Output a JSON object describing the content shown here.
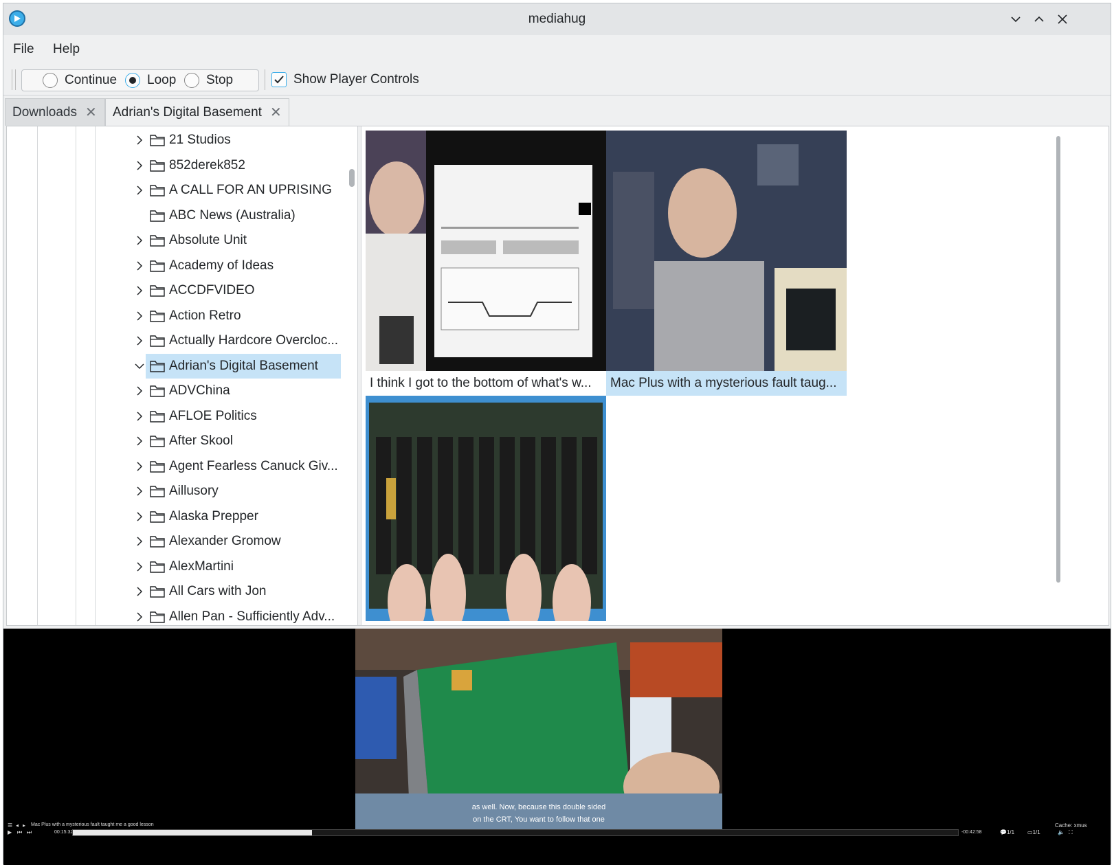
{
  "window": {
    "title": "mediahug"
  },
  "menu": {
    "items": [
      "File",
      "Help"
    ]
  },
  "toolbar": {
    "radios": [
      {
        "label": "Continue",
        "checked": false
      },
      {
        "label": "Loop",
        "checked": true
      },
      {
        "label": "Stop",
        "checked": false
      }
    ],
    "show_controls_label": "Show Player Controls",
    "show_controls_checked": true
  },
  "tabs": [
    {
      "label": "Downloads",
      "active": false
    },
    {
      "label": "Adrian's Digital Basement",
      "active": true
    }
  ],
  "tree": {
    "items": [
      {
        "label": "21 Studios",
        "expandable": true
      },
      {
        "label": "852derek852",
        "expandable": true
      },
      {
        "label": "A CALL FOR AN UPRISING",
        "expandable": true
      },
      {
        "label": "ABC News (Australia)",
        "expandable": false
      },
      {
        "label": "Absolute Unit",
        "expandable": true
      },
      {
        "label": "Academy of Ideas",
        "expandable": true
      },
      {
        "label": "ACCDFVIDEO",
        "expandable": true
      },
      {
        "label": "Action Retro",
        "expandable": true
      },
      {
        "label": "Actually Hardcore Overcloc...",
        "expandable": true
      },
      {
        "label": "Adrian's Digital Basement",
        "expandable": true,
        "expanded": true,
        "selected": true
      },
      {
        "label": "ADVChina",
        "expandable": true
      },
      {
        "label": "AFLOE Politics",
        "expandable": true
      },
      {
        "label": "After Skool",
        "expandable": true
      },
      {
        "label": "Agent Fearless Canuck Giv...",
        "expandable": true
      },
      {
        "label": "Aillusory",
        "expandable": true
      },
      {
        "label": "Alaska Prepper",
        "expandable": true
      },
      {
        "label": "Alexander Gromow",
        "expandable": true
      },
      {
        "label": "AlexMartini",
        "expandable": true
      },
      {
        "label": "All Cars with Jon",
        "expandable": true
      },
      {
        "label": "Allen Pan - Sufficiently Adv...",
        "expandable": true
      }
    ]
  },
  "videos": [
    {
      "caption": "I think I got to the bottom of what's w...",
      "highlighted": false
    },
    {
      "caption": "Mac Plus with a mysterious fault taug...",
      "highlighted": true
    },
    {
      "caption": "",
      "highlighted": false
    }
  ],
  "player": {
    "subtitle_line1": "as well. Now, because this double sided",
    "subtitle_line2": "on the CRT, You want to follow that one",
    "now_playing": "Mac Plus with a mysterious fault taught me a good lesson",
    "elapsed": "00:15:32",
    "remaining": "-00:42:58",
    "progress": 0.27,
    "cache_label": "Cache: xmus",
    "sub_track": "1/1",
    "audio_track": "1/1"
  }
}
